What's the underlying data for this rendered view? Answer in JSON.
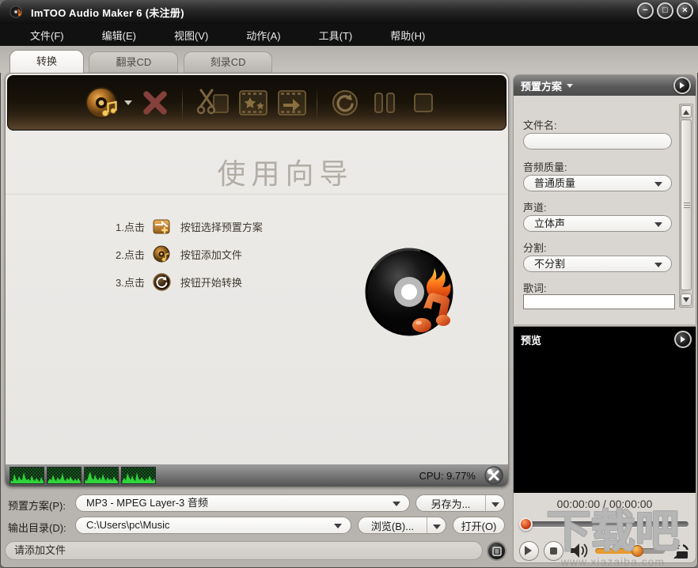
{
  "window": {
    "title": "ImTOO Audio Maker 6 (未注册)",
    "controls": {
      "minimize": "−",
      "maximize": "□",
      "close": "×"
    }
  },
  "menu": {
    "items": [
      "文件(F)",
      "编辑(E)",
      "视图(V)",
      "动作(A)",
      "工具(T)",
      "帮助(H)"
    ]
  },
  "tabs": {
    "convert": "转换",
    "rip": "翻录CD",
    "burn": "刻录CD"
  },
  "wizard": {
    "title": "使用向导",
    "steps": [
      {
        "action": "1.点击",
        "desc": "按钮选择预置方案"
      },
      {
        "action": "2.点击",
        "desc": "按钮添加文件"
      },
      {
        "action": "3.点击",
        "desc": "按钮开始转换"
      }
    ]
  },
  "preset_panel": {
    "title": "预置方案",
    "filename_label": "文件名:",
    "quality_label": "音频质量:",
    "quality_value": "普通质量",
    "channel_label": "声道:",
    "channel_value": "立体声",
    "split_label": "分割:",
    "split_value": "不分割",
    "lyrics_label": "歌词:"
  },
  "meter_bar": {
    "cpu": "CPU: 9.77%"
  },
  "output_bar": {
    "preset_label": "预置方案(P):",
    "preset_value": "MP3 - MPEG Layer-3 音频",
    "save_as_label": "另存为...",
    "dir_label": "输出目录(D):",
    "dir_value": "C:\\Users\\pc\\Music",
    "browse_label": "浏览(B)...",
    "open_label": "打开(O)"
  },
  "message_bar": {
    "text": "请添加文件"
  },
  "preview": {
    "title": "预览",
    "time": "00:00:00 / 00:00:00"
  },
  "watermark": {
    "text": "下载吧",
    "site": "www.xiazaiba.com"
  },
  "colors": {
    "meter_green": "#2fd43a",
    "toolbar_brown": "#54402a",
    "knob_orange": "#e89a2e",
    "seek_knob_red": "#c23210"
  }
}
